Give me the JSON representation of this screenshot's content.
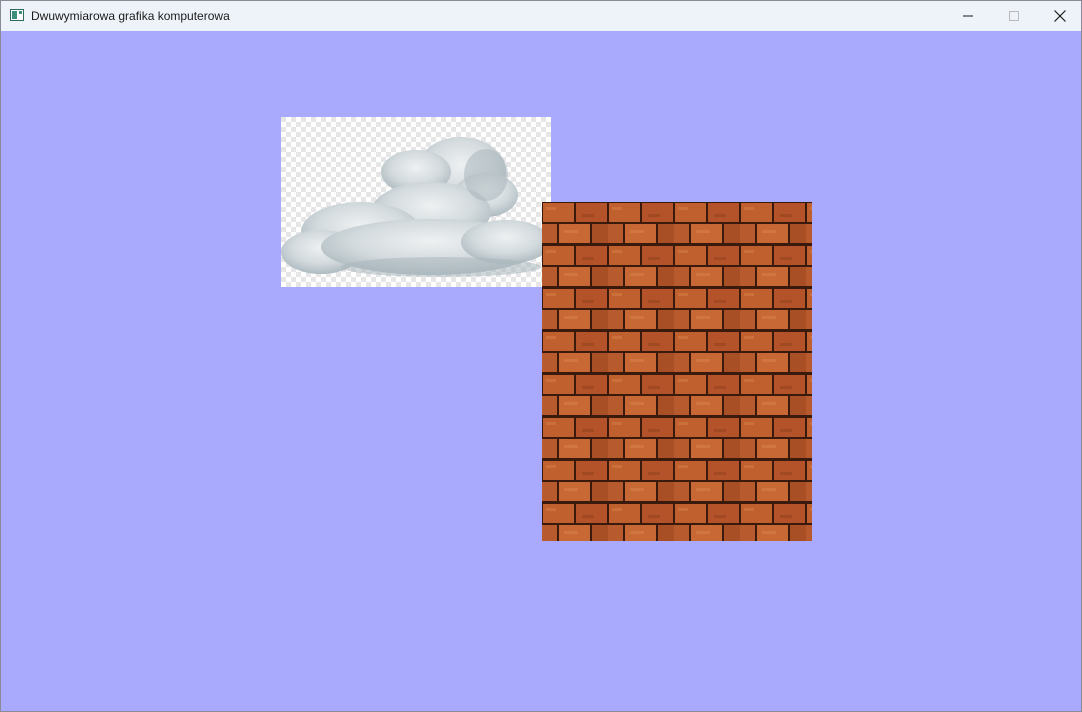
{
  "window": {
    "title": "Dwuwymiarowa grafika komputerowa",
    "icon": "app-window-icon",
    "controls": {
      "minimize": "minimize-icon",
      "maximize": "maximize-icon",
      "close": "close-icon"
    }
  },
  "canvas": {
    "background_color": "#a9a9fd",
    "sprites": [
      {
        "name": "cloud",
        "description_icon": "cloud-texture"
      },
      {
        "name": "brick-wall",
        "description_icon": "brick-texture"
      }
    ]
  },
  "colors": {
    "titlebar": "#eef3fa",
    "brick": "#b8582a",
    "mortar": "#3a1a0c",
    "cloud": "#d8dfe3"
  }
}
